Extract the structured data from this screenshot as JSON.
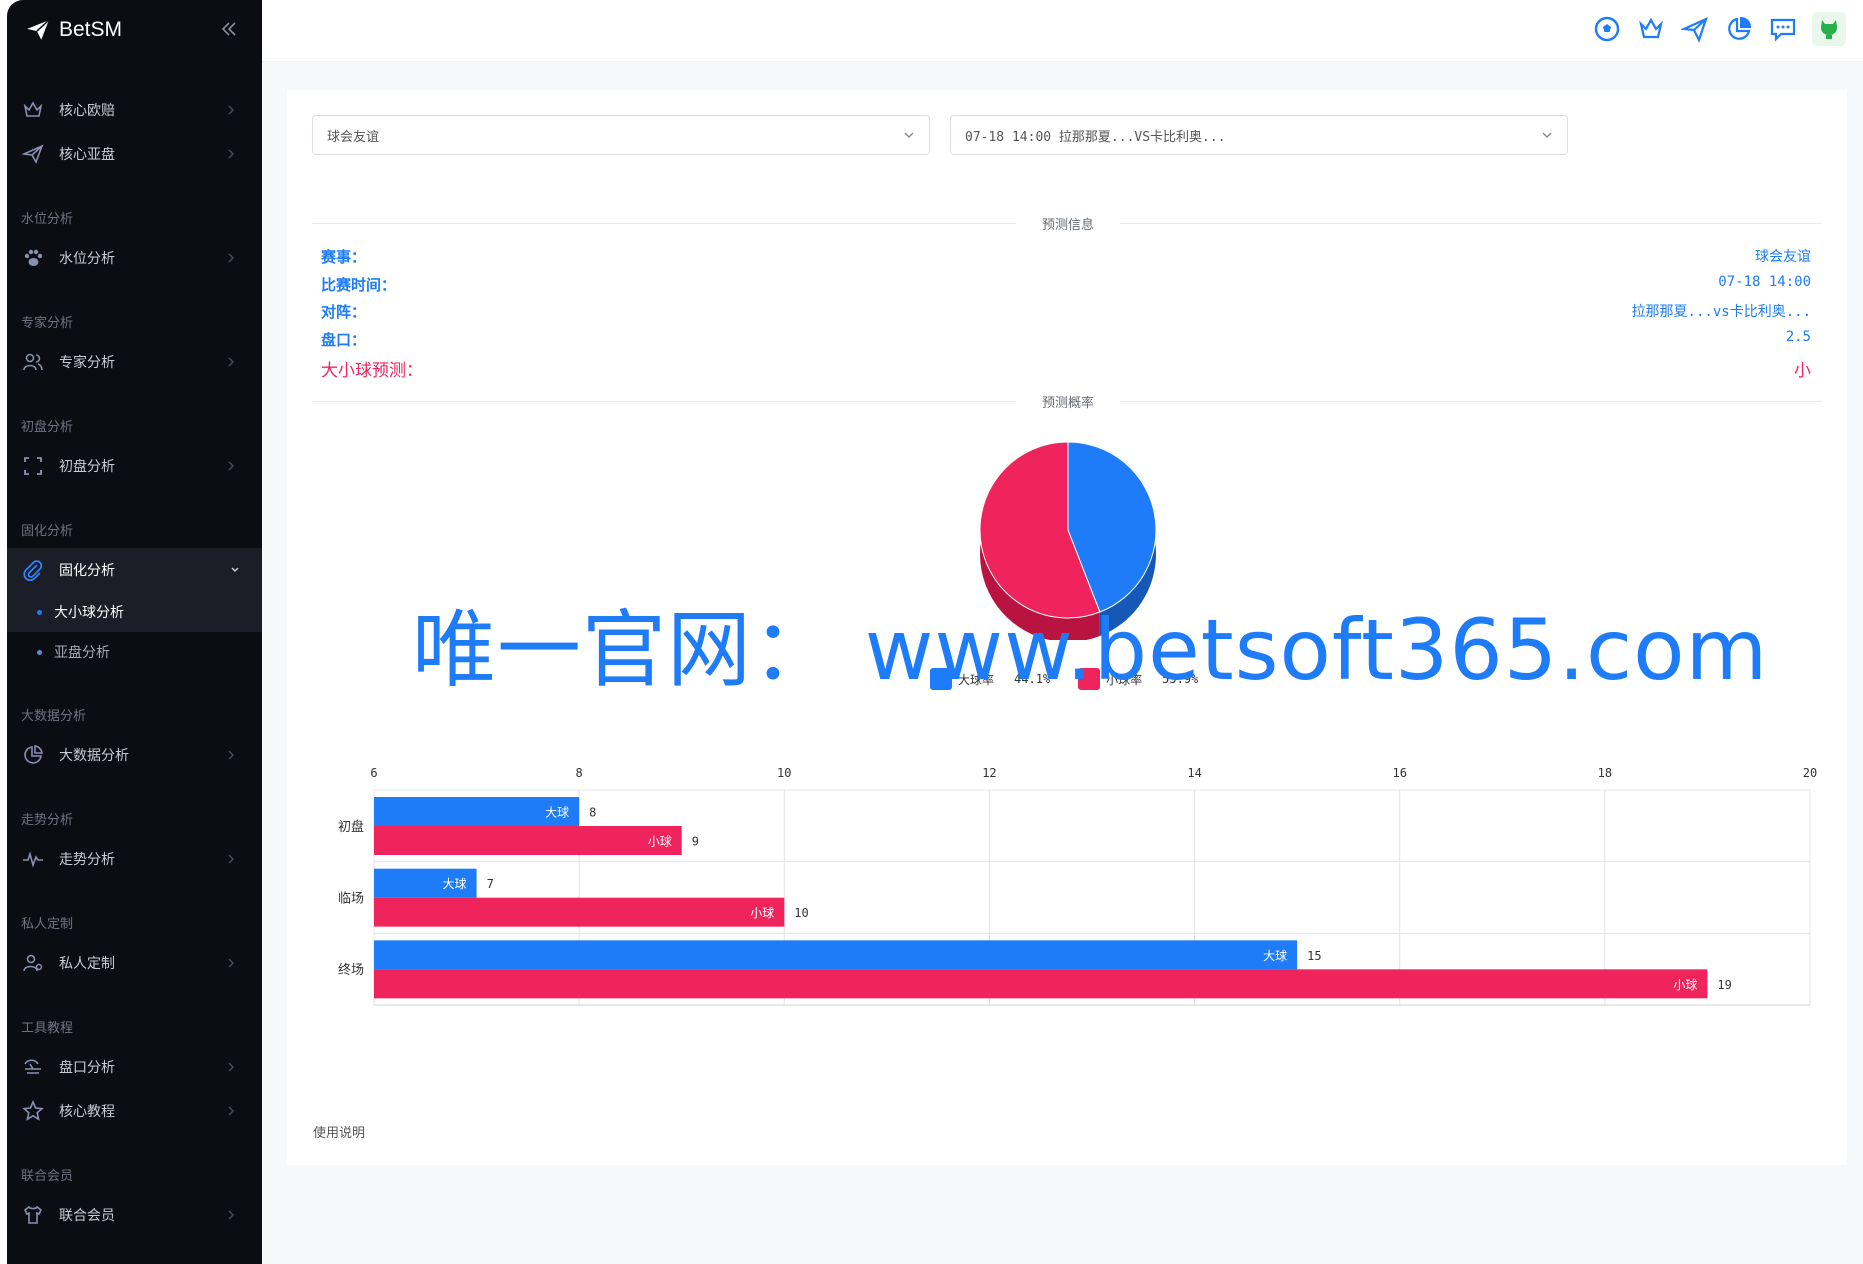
{
  "app": {
    "name": "BetSM"
  },
  "sidebar": {
    "items_top": [
      {
        "label": "核心欧赔",
        "icon": "crown-icon"
      },
      {
        "label": "核心亚盘",
        "icon": "paper-plane-icon"
      }
    ],
    "groups": [
      {
        "title": "水位分析",
        "item": "水位分析",
        "icon": "paw-icon"
      },
      {
        "title": "专家分析",
        "item": "专家分析",
        "icon": "users-icon"
      },
      {
        "title": "初盘分析",
        "item": "初盘分析",
        "icon": "frame-icon"
      },
      {
        "title": "固化分析",
        "item": "固化分析",
        "icon": "paperclip-icon"
      },
      {
        "title": "大数据分析",
        "item": "大数据分析",
        "icon": "pie-chart-icon"
      },
      {
        "title": "走势分析",
        "item": "走势分析",
        "icon": "pulse-icon"
      },
      {
        "title": "私人定制",
        "item": "私人定制",
        "icon": "user-gear-icon"
      },
      {
        "title": "工具教程",
        "item": "盘口分析",
        "icon": "tool-icon"
      },
      {
        "title": "联合会员",
        "item": "联合会员",
        "icon": "shirt-icon"
      }
    ],
    "tutorial_item": "核心教程",
    "sub_items": [
      "大小球分析",
      "亚盘分析"
    ]
  },
  "filters": {
    "league": "球会友谊",
    "match": "07-18 14:00 拉那那夏...VS卡比利奥..."
  },
  "sections": {
    "info": "预测信息",
    "prob": "预测概率"
  },
  "info": {
    "league_label": "赛事：",
    "league_value": "球会友谊",
    "time_label": "比赛时间：",
    "time_value": "07-18 14:00",
    "match_label": "对阵：",
    "match_value": "拉那那夏...vs卡比利奥...",
    "line_label": "盘口：",
    "line_value": "2.5",
    "pred_label": "大小球预测：",
    "pred_value": "小"
  },
  "watermark": "唯一官网： www.betsoft365.com",
  "colors": {
    "big": "#1e7cf8",
    "small": "#f0245d"
  },
  "chart_data": [
    {
      "type": "pie",
      "labels": [
        "大球率",
        "小球率"
      ],
      "values": [
        44.1,
        55.9
      ],
      "value_labels": [
        "44.1%",
        "55.9%"
      ]
    },
    {
      "type": "bar",
      "orientation": "horizontal",
      "categories": [
        "初盘",
        "临场",
        "终场"
      ],
      "series": [
        {
          "name": "大球",
          "values": [
            8,
            7,
            15
          ]
        },
        {
          "name": "小球",
          "values": [
            9,
            10,
            19
          ]
        }
      ],
      "xlim": [
        6,
        20
      ],
      "xticks": [
        "6",
        "8",
        "10",
        "12",
        "14",
        "16",
        "18",
        "20"
      ],
      "grid": true
    }
  ],
  "footer": {
    "link": "使用说明"
  }
}
